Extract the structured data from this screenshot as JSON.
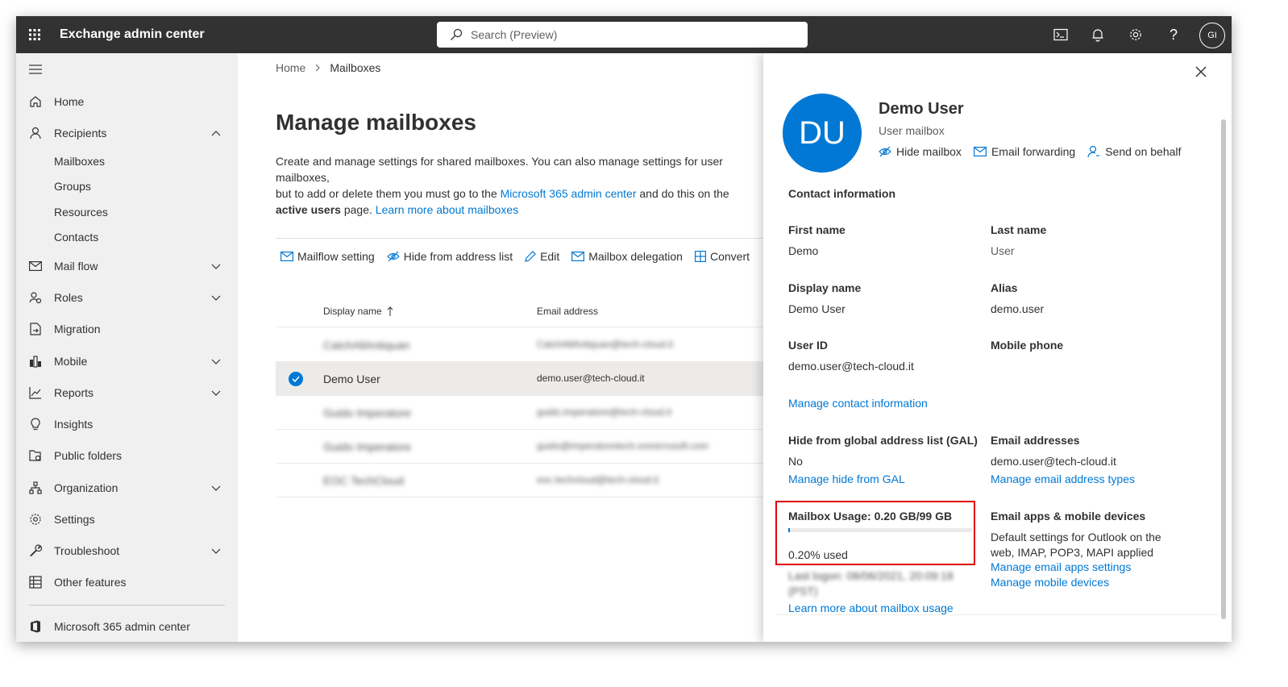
{
  "app": {
    "title": "Exchange admin center"
  },
  "search": {
    "placeholder": "Search (Preview)"
  },
  "topbar": {
    "avatar_initials": "GI"
  },
  "sidebar": {
    "items": [
      {
        "label": "Home"
      },
      {
        "label": "Recipients"
      },
      {
        "label": "Mail flow"
      },
      {
        "label": "Roles"
      },
      {
        "label": "Migration"
      },
      {
        "label": "Mobile"
      },
      {
        "label": "Reports"
      },
      {
        "label": "Insights"
      },
      {
        "label": "Public folders"
      },
      {
        "label": "Organization"
      },
      {
        "label": "Settings"
      },
      {
        "label": "Troubleshoot"
      },
      {
        "label": "Other features"
      },
      {
        "label": "Microsoft 365 admin center"
      }
    ],
    "recipients_sub": [
      "Mailboxes",
      "Groups",
      "Resources",
      "Contacts"
    ]
  },
  "breadcrumb": {
    "home": "Home",
    "current": "Mailboxes"
  },
  "page": {
    "title": "Manage mailboxes",
    "desc_1": "Create and manage settings for shared mailboxes. You can also manage settings for user mailboxes,",
    "desc_2": "but to add or delete them you must go to the ",
    "desc_link_1": "Microsoft 365 admin center",
    "desc_3": " and do this on the",
    "desc_bold": "active users",
    "desc_4": " page. ",
    "desc_link_2": "Learn more about mailboxes"
  },
  "toolbar": {
    "mailflow": "Mailflow setting",
    "hide": "Hide from address list",
    "edit": "Edit",
    "delegation": "Mailbox delegation",
    "convert": "Convert"
  },
  "grid": {
    "col_name": "Display name",
    "col_email": "Email address",
    "rows": [
      {
        "name": "CatchAllAntiquan",
        "email": "CatchAllAntiquan@tech-cloud.it"
      },
      {
        "name": "Demo User",
        "email": "demo.user@tech-cloud.it"
      },
      {
        "name": "Guido Imperatore",
        "email": "guido.imperatore@tech-cloud.it"
      },
      {
        "name": "Guido Imperatore",
        "email": "guido@imperatoretech.onmicrosoft.com"
      },
      {
        "name": "EOC TechCloud",
        "email": "eoc.techcloud@tech-cloud.it"
      }
    ]
  },
  "panel": {
    "initials": "DU",
    "name": "Demo User",
    "type": "User mailbox",
    "actions": {
      "hide": "Hide mailbox",
      "forwarding": "Email forwarding",
      "send_behalf": "Send on behalf"
    },
    "contact_header": "Contact information",
    "first_name_label": "First name",
    "first_name": "Demo",
    "last_name_label": "Last name",
    "last_name": "User",
    "display_name_label": "Display name",
    "display_name": "Demo User",
    "alias_label": "Alias",
    "alias": "demo.user",
    "user_id_label": "User ID",
    "user_id": "demo.user@tech-cloud.it",
    "mobile_label": "Mobile phone",
    "manage_contact": "Manage contact information",
    "gal_label": "Hide from global address list (GAL)",
    "gal_value": "No",
    "manage_gal": "Manage hide from GAL",
    "email_addr_label": "Email addresses",
    "email_addr": "demo.user@tech-cloud.it",
    "manage_email_types": "Manage email address types",
    "usage_label": "Mailbox Usage: 0.20 GB/99 GB",
    "usage_fraction": 0.002,
    "usage_used": "0.20% used",
    "last_logon": "Last logon: 08/06/2021, 20:09:18",
    "last_logon_2": "(PST)",
    "learn_usage": "Learn more about mailbox usage",
    "apps_label": "Email apps & mobile devices",
    "apps_desc_1": "Default settings for Outlook on the",
    "apps_desc_2": "web, IMAP, POP3, MAPI applied",
    "manage_apps": "Manage email apps settings",
    "manage_mobile": "Manage mobile devices"
  }
}
